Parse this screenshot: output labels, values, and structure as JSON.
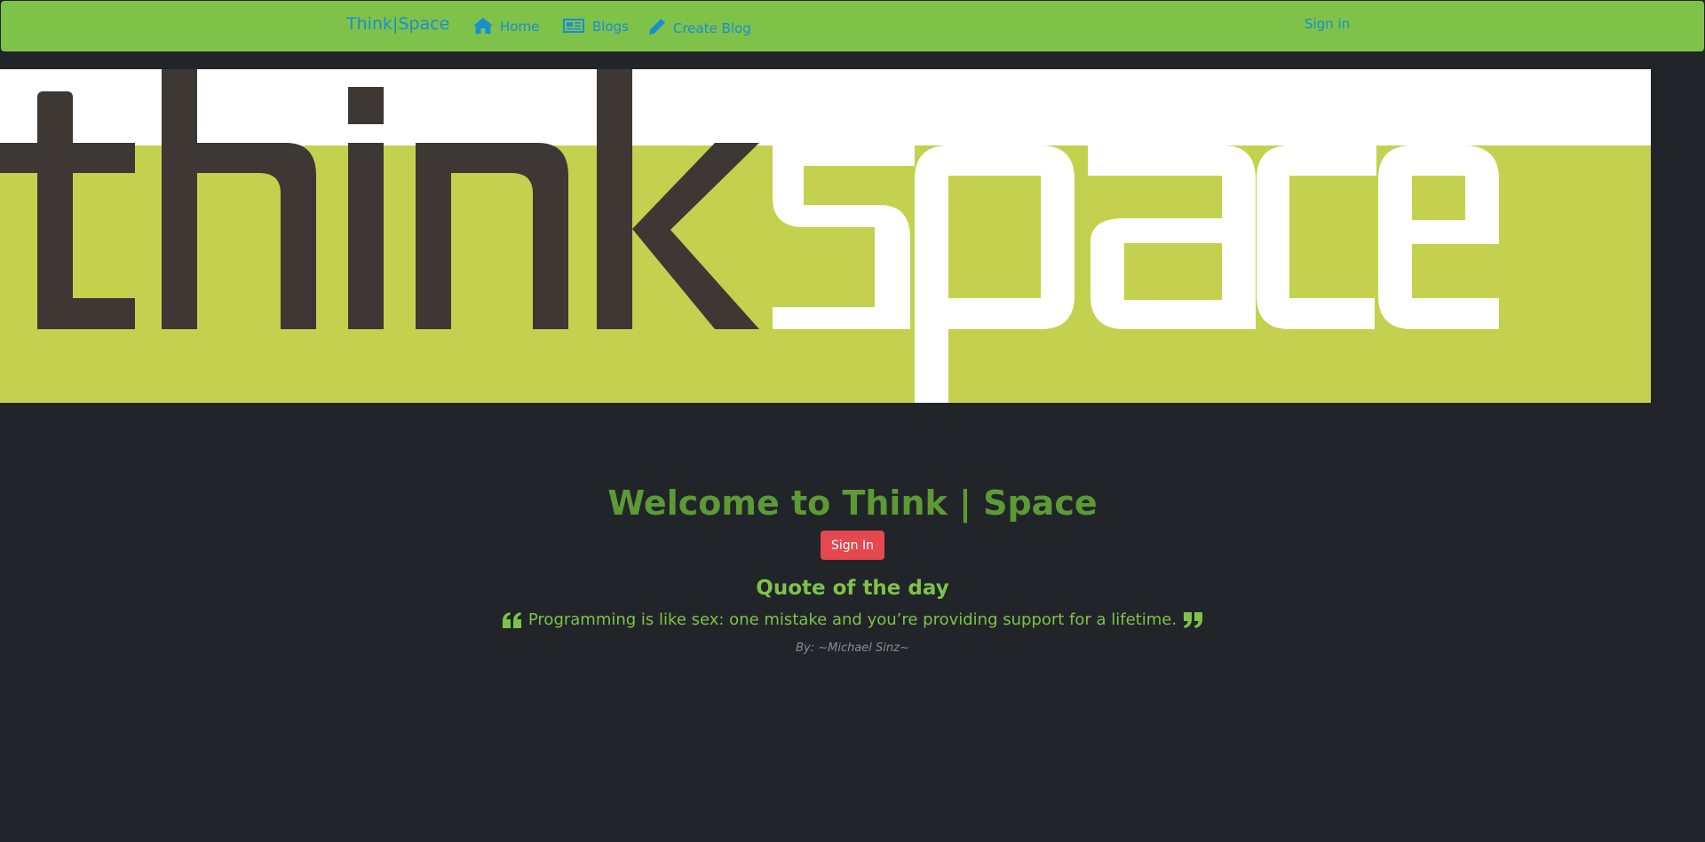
{
  "navbar": {
    "brand": "Think|Space",
    "links": [
      {
        "label": "Home",
        "icon": "home-icon"
      },
      {
        "label": "Blogs",
        "icon": "newspaper-icon"
      },
      {
        "label": "Create Blog",
        "icon": "pencil-icon"
      }
    ],
    "signin": "Sign in"
  },
  "banner": {
    "word_left": "think",
    "word_right": "space"
  },
  "main": {
    "welcome": "Welcome to Think | Space",
    "signin_button": "Sign In",
    "quote_title": "Quote of the day",
    "quote_text": "Programming is like sex: one mistake and you’re providing support for a lifetime.",
    "quote_author": "By: ~Michael Sinz~"
  },
  "colors": {
    "navbar_bg": "#7ec24a",
    "link": "#1a8fd0",
    "page_bg": "#212529",
    "banner_green": "#c4d14e",
    "banner_dark": "#3d3834",
    "button": "#e5484f"
  }
}
